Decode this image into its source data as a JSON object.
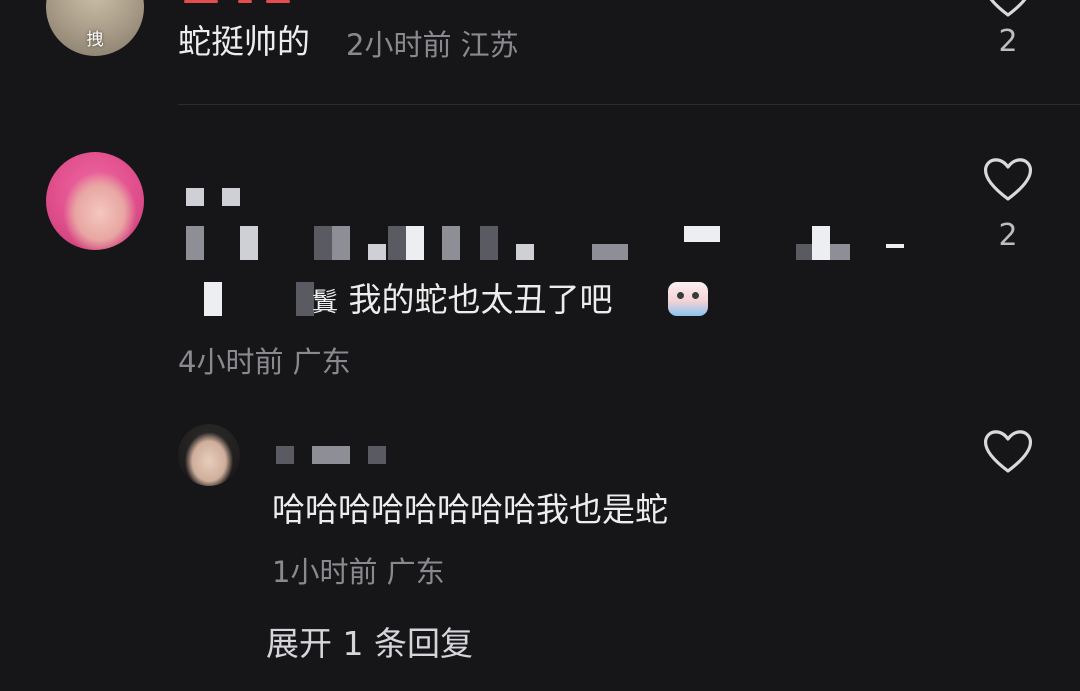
{
  "comments": [
    {
      "avatar_label": "拽",
      "text": "蛇挺帅的",
      "time": "2小时前",
      "location": "江苏",
      "likes": "2"
    },
    {
      "text_visible": "我的蛇也太丑了吧",
      "text_prefix_glyph": "鬒",
      "time": "4小时前",
      "location": "广东",
      "likes": "2"
    }
  ],
  "reply": {
    "text": "哈哈哈哈哈哈哈哈我也是蛇",
    "time": "1小时前",
    "location": "广东"
  },
  "expand_label": "展开 1 条回复",
  "icons": {
    "like": "heart-outline-icon",
    "emoji": "crying-face-emoji"
  },
  "colors": {
    "background": "#161619",
    "primary_text": "#ededed",
    "meta_text": "#8a8a8e",
    "accent_red": "#e24d4d"
  }
}
